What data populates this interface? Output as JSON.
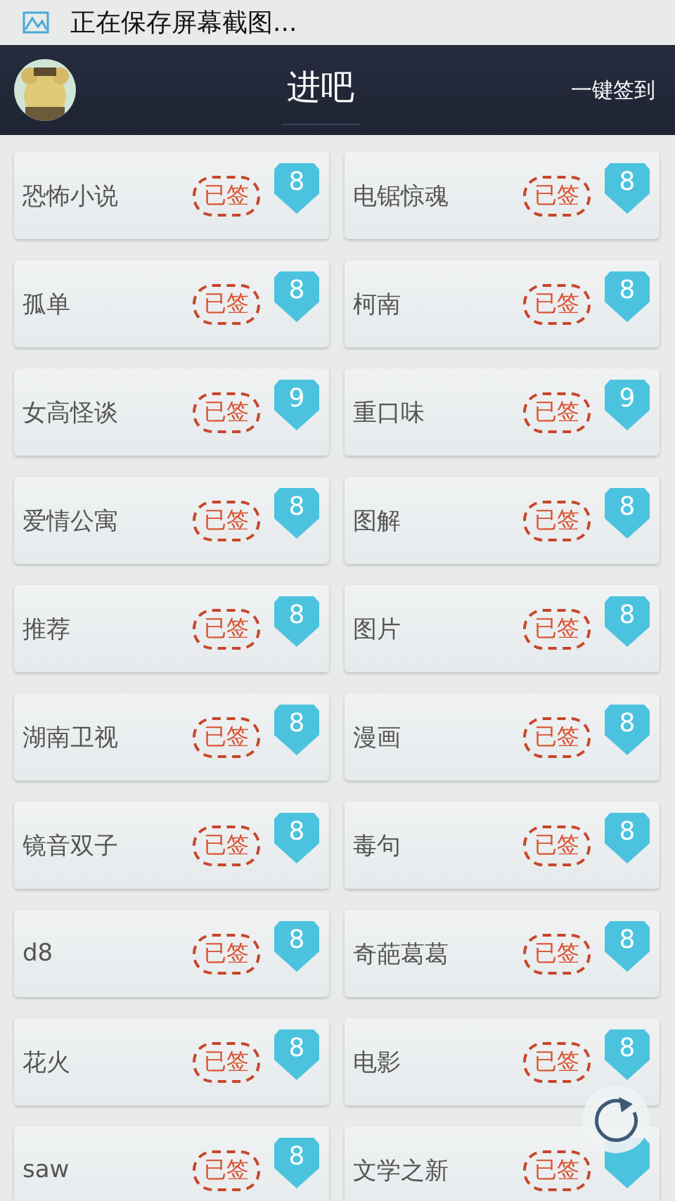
{
  "status_bar": {
    "text": "正在保存屏幕截图..."
  },
  "header": {
    "title": "进吧",
    "action": "一键签到"
  },
  "forums": [
    {
      "name": "恐怖小说",
      "signed": true,
      "stamp": "已签",
      "count": "8"
    },
    {
      "name": "电锯惊魂",
      "signed": true,
      "stamp": "已签",
      "count": "8"
    },
    {
      "name": "孤单",
      "signed": true,
      "stamp": "已签",
      "count": "8"
    },
    {
      "name": "柯南",
      "signed": true,
      "stamp": "已签",
      "count": "8"
    },
    {
      "name": "女高怪谈",
      "signed": true,
      "stamp": "已签",
      "count": "9"
    },
    {
      "name": "重口味",
      "signed": true,
      "stamp": "已签",
      "count": "9"
    },
    {
      "name": "爱情公寓",
      "signed": true,
      "stamp": "已签",
      "count": "8"
    },
    {
      "name": "图解",
      "signed": true,
      "stamp": "已签",
      "count": "8"
    },
    {
      "name": "推荐",
      "signed": true,
      "stamp": "已签",
      "count": "8"
    },
    {
      "name": "图片",
      "signed": true,
      "stamp": "已签",
      "count": "8"
    },
    {
      "name": "湖南卫视",
      "signed": true,
      "stamp": "已签",
      "count": "8"
    },
    {
      "name": "漫画",
      "signed": true,
      "stamp": "已签",
      "count": "8"
    },
    {
      "name": "镜音双子",
      "signed": true,
      "stamp": "已签",
      "count": "8"
    },
    {
      "name": "毒句",
      "signed": true,
      "stamp": "已签",
      "count": "8"
    },
    {
      "name": "d8",
      "signed": true,
      "stamp": "已签",
      "count": "8"
    },
    {
      "name": "奇葩葛葛",
      "signed": true,
      "stamp": "已签",
      "count": "8"
    },
    {
      "name": "花火",
      "signed": true,
      "stamp": "已签",
      "count": "8"
    },
    {
      "name": "电影",
      "signed": true,
      "stamp": "已签",
      "count": "8"
    },
    {
      "name": "saw",
      "signed": true,
      "stamp": "已签",
      "count": "8"
    },
    {
      "name": "文学之新",
      "signed": true,
      "stamp": "已签"
    }
  ]
}
